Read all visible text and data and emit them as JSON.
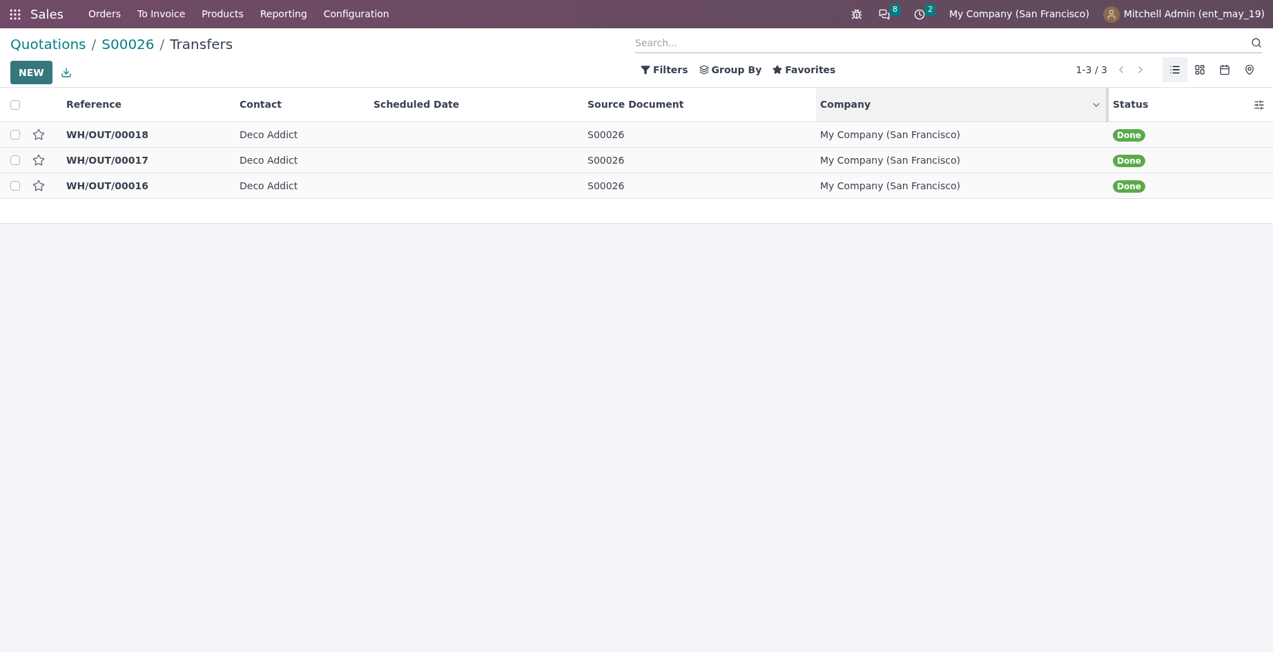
{
  "navbar": {
    "app": "Sales",
    "menu": [
      "Orders",
      "To Invoice",
      "Products",
      "Reporting",
      "Configuration"
    ],
    "messages_count": "8",
    "activities_count": "2",
    "company": "My Company (San Francisco)",
    "user": "Mitchell Admin (ent_may_19)"
  },
  "breadcrumbs": [
    {
      "label": "Quotations",
      "kind": "link"
    },
    {
      "separator": "/",
      "label": "S00026",
      "kind": "link"
    },
    {
      "separator": "/",
      "label": "Transfers",
      "kind": "current"
    }
  ],
  "select_all": {
    "checked": false
  },
  "buttons": {
    "new": "NEW"
  },
  "search": {
    "placeholder": "Search..."
  },
  "filters": [
    {
      "label": "Filters",
      "kind": "filter"
    },
    {
      "label": "Group By",
      "kind": "group"
    },
    {
      "label": "Favorites",
      "kind": "star"
    }
  ],
  "pager": "1-3 / 3",
  "views": [
    {
      "kind": "list",
      "selected": true
    },
    {
      "kind": "kanban",
      "selected": false
    },
    {
      "kind": "calendar",
      "selected": false
    },
    {
      "kind": "map",
      "selected": false
    }
  ],
  "table": {
    "columns": [
      {
        "label": "Reference",
        "sorted": false
      },
      {
        "label": "Contact",
        "sorted": false
      },
      {
        "label": "Scheduled Date",
        "sorted": false
      },
      {
        "label": "Source Document",
        "sorted": false
      },
      {
        "label": "Company",
        "sorted": true
      },
      {
        "label": "Status",
        "sorted": false
      }
    ],
    "rows": [
      {
        "reference": "WH/OUT/00018",
        "contact": "Deco Addict",
        "source": "S00026",
        "company": "My Company (San Francisco)",
        "status": "Done",
        "checked": false,
        "starred": false
      },
      {
        "reference": "WH/OUT/00017",
        "contact": "Deco Addict",
        "source": "S00026",
        "company": "My Company (San Francisco)",
        "status": "Done",
        "checked": false,
        "starred": false
      },
      {
        "reference": "WH/OUT/00016",
        "contact": "Deco Addict",
        "source": "S00026",
        "company": "My Company (San Francisco)",
        "status": "Done",
        "checked": false,
        "starred": false
      }
    ]
  }
}
